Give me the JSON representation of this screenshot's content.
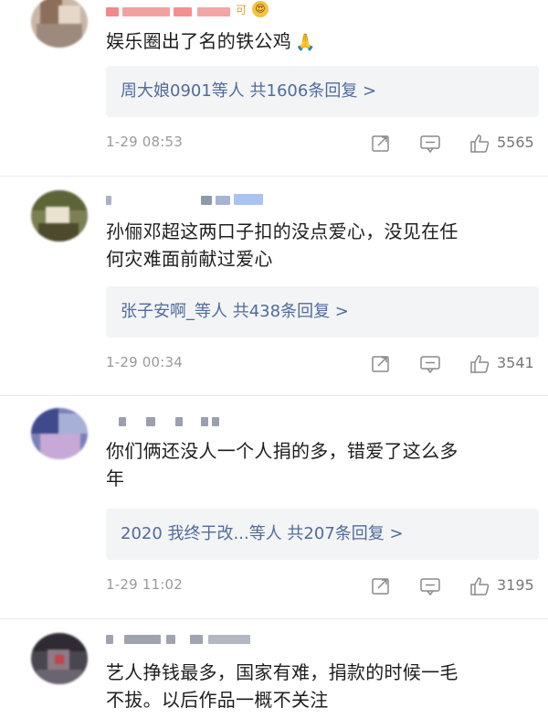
{
  "comments": [
    {
      "user_tag": "可",
      "emoji": "😍",
      "text": "娱乐圈出了名的铁公鸡",
      "text_emoji": "🙏",
      "replies": "周大娘0901等人 共1606条回复 >",
      "time": "1-29 08:53",
      "likes": "5565"
    },
    {
      "text_line1": "孙俪邓超这两口子扣的没点爱心，没见在任",
      "text_line2": "何灾难面前献过爱心",
      "replies": "张子安啊_等人 共438条回复 >",
      "time": "1-29 00:34",
      "likes": "3541"
    },
    {
      "text_line1": "你们俩还没人一个人捐的多，错爱了这么多",
      "text_line2": "年",
      "replies": "2020 我终于改...等人 共207条回复 >",
      "time": "1-29 11:02",
      "likes": "3195"
    },
    {
      "text_line1": "艺人挣钱最多，国家有难，捐款的时候一毛",
      "text_line2": "不拔。以后作品一概不关注"
    }
  ],
  "colors": {
    "reply_link": "#506c9a",
    "reply_bg": "#f3f4f6",
    "meta_gray": "#9a9a9a"
  },
  "icons": [
    "share-icon",
    "comment-icon",
    "like-icon"
  ]
}
